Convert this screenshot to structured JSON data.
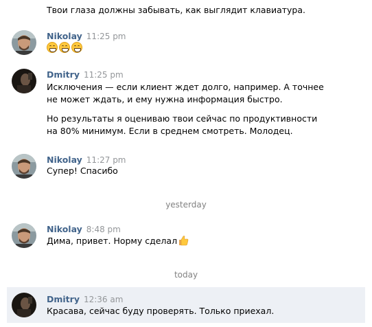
{
  "messages": [
    {
      "continuation_text": "Твои глаза должны забывать, как выглядит клавиатура."
    },
    {
      "author": "Nikolay",
      "time": "11:25 pm",
      "emoji": [
        "grimacing-face",
        "grimacing-face",
        "grimacing-face"
      ]
    },
    {
      "author": "Dmitry",
      "time": "11:25 pm",
      "paragraph1": "Исключения — если клиент ждет долго, например. А точнее не может ждать, и ему нужна информация быстро.",
      "paragraph2": "Но результаты я оцениваю твои сейчас по продуктивности на 80% минимум. Если в среднем смотреть. Молодец."
    },
    {
      "author": "Nikolay",
      "time": "11:27 pm",
      "text": "Супер! Спасибо"
    },
    {
      "divider": "yesterday"
    },
    {
      "author": "Nikolay",
      "time": "8:48 pm",
      "text": "Дима, привет. Норму сделал",
      "emoji": "thumbs-up"
    },
    {
      "divider": "today"
    },
    {
      "author": "Dmitry",
      "time": "12:36 am",
      "text": "Красава, сейчас буду проверять. Только приехал.",
      "highlighted": true
    }
  ],
  "colors": {
    "author_name": "#42648b",
    "timestamp": "#939699",
    "divider_text": "#828282",
    "highlight_bg": "#edf0f5"
  }
}
